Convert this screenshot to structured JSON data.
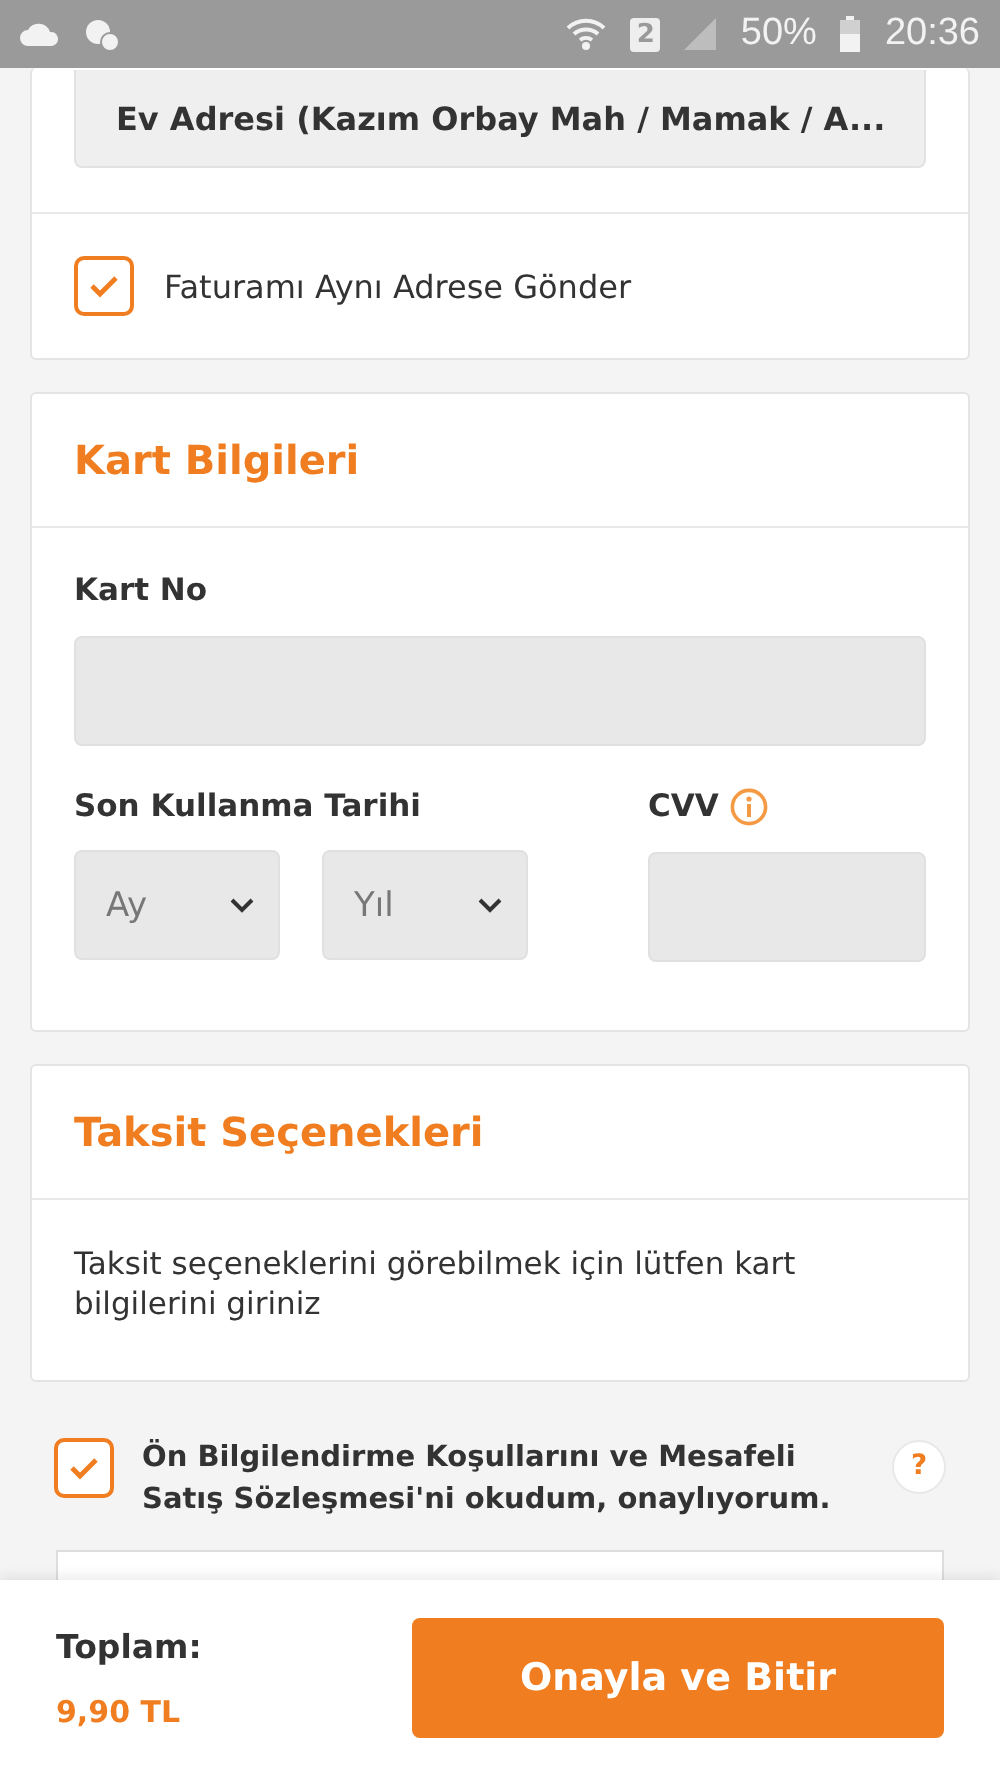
{
  "status_bar": {
    "battery_text": "50%",
    "sim": "2",
    "time": "20:36"
  },
  "address": {
    "value": "Ev Adresi (Kazım Orbay Mah / Mamak / A..."
  },
  "billing_same": {
    "label": "Faturamı Aynı Adrese Gönder",
    "checked": true
  },
  "card_info": {
    "title": "Kart Bilgileri",
    "card_no_label": "Kart No",
    "expiry_label": "Son Kullanma Tarihi",
    "month_placeholder": "Ay",
    "year_placeholder": "Yıl",
    "cvv_label": "CVV"
  },
  "installments": {
    "title": "Taksit Seçenekleri",
    "message": "Taksit seçeneklerini görebilmek için lütfen kart bilgilerini giriniz"
  },
  "agreement": {
    "label": "Ön Bilgilendirme Koşullarını ve Mesafeli Satış Sözleşmesi'ni okudum, onaylıyorum.",
    "checked": true,
    "help": "?"
  },
  "footer": {
    "total_label": "Toplam:",
    "total": "9,90 TL",
    "button": "Onayla ve Bitir"
  }
}
